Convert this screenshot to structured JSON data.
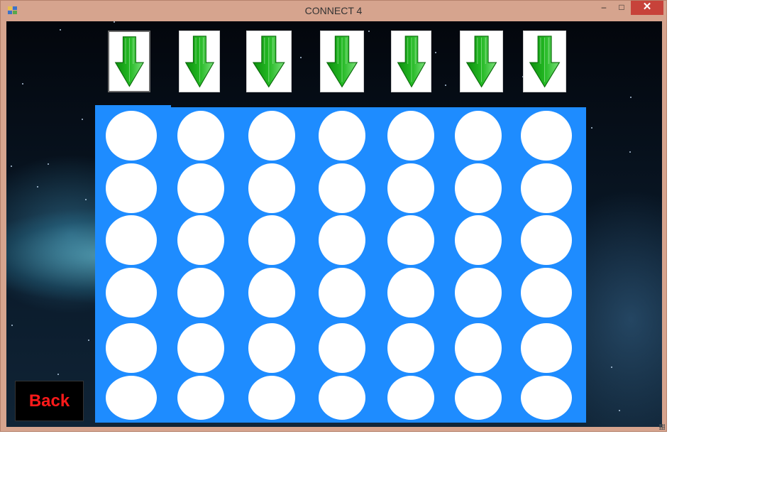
{
  "window": {
    "title": "CONNECT 4",
    "controls": {
      "minimize": "–",
      "maximize": "□",
      "close": "✕"
    }
  },
  "icons": {
    "app": "app-window-icon",
    "drop": "green-down-arrow-icon"
  },
  "colors": {
    "board": "#1e8cff",
    "slot_empty": "#ffffff",
    "back_text": "#ff1a1a",
    "arrow": "#22b822"
  },
  "board": {
    "columns": 7,
    "rows": 6,
    "selected_column": 1
  },
  "back_button": {
    "label": "Back"
  }
}
